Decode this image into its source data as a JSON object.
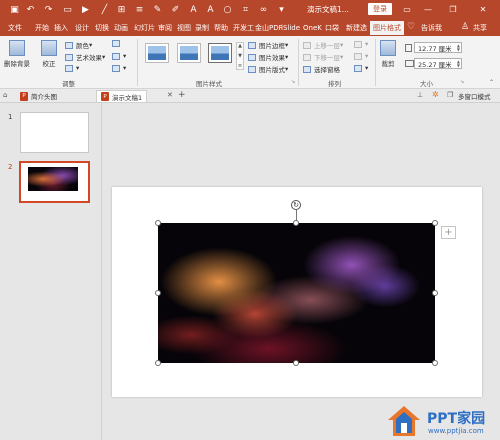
{
  "titlebar": {
    "doc_title": "演示文稿1...",
    "login_label": "登录",
    "win_minimize": "—",
    "win_restore": "❐",
    "win_close": "✕"
  },
  "menu_tabs": [
    "文件",
    "开始",
    "插入",
    "设计",
    "切换",
    "动画",
    "幻灯片",
    "审阅",
    "视图",
    "录制",
    "帮助",
    "开发工",
    "金山PDF",
    "iSlide",
    "OneK",
    "口袋",
    "新建选",
    "图片格式"
  ],
  "active_tab": "图片格式",
  "tell_me": "告诉我",
  "share": "共享",
  "ribbon": {
    "remove_bg": "删除背景",
    "correct": "校正",
    "color": "颜色",
    "art_effects": "艺术效果",
    "adjust_group": "调整",
    "picture_border": "图片边框",
    "picture_effects": "图片效果",
    "picture_layout": "图片版式",
    "styles_group": "图片样式",
    "bring_forward": "上移一层",
    "send_backward": "下移一层",
    "selection_pane": "选择窗格",
    "arrange_group": "排列",
    "crop": "裁剪",
    "height_value": "12.77 厘米",
    "width_value": "25.27 厘米",
    "size_group": "大小"
  },
  "doc_tabs": {
    "tab1": "简介头图",
    "tab2": "演示文稿1",
    "new_tab": "+",
    "multi_window": "多窗口模式"
  },
  "slides": {
    "slide1_num": "1",
    "slide2_num": "2"
  },
  "watermark": {
    "brand": "PPT家园",
    "url": "www.pptjia.com"
  }
}
